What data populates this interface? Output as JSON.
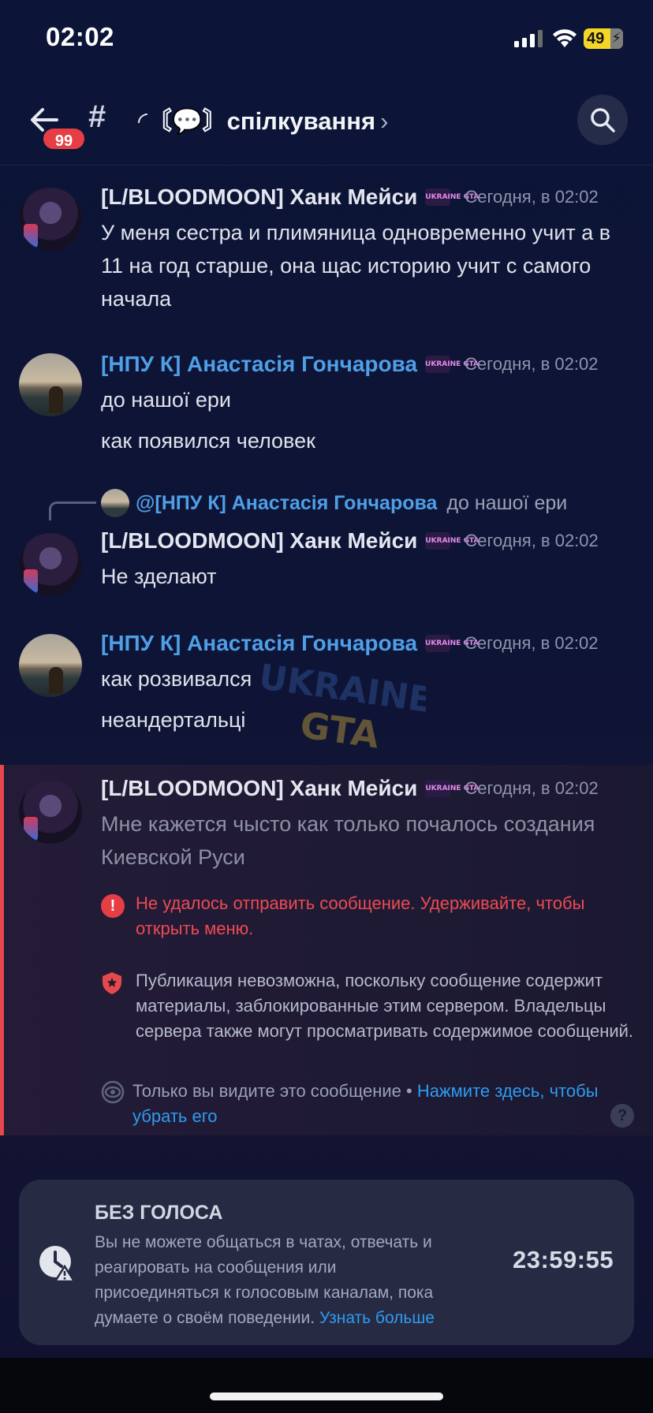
{
  "status_bar": {
    "time": "02:02",
    "battery": "49"
  },
  "header": {
    "unread_count": "99",
    "channel_title": "◜〘💬〙спілкування",
    "chevron": "›"
  },
  "messages": [
    {
      "author": "[L/BLOODMOON] Ханк Мейси",
      "tag": "UKRAINE GTA",
      "timestamp": "Сегодня, в 02:02",
      "lines": [
        "У меня сестра и плимяница одновременно учит а в 11 на год старше, она щас историю учит с самого начала"
      ]
    },
    {
      "author": "[НПУ К] Анастасія Гончарова",
      "tag": "UKRAINE GTA",
      "timestamp": "Сегодня, в 02:02",
      "lines": [
        "до нашої ери",
        "как появился человек"
      ]
    },
    {
      "reply_mention": "@[НПУ К] Анастасія Гончарова",
      "reply_text": "до нашої ери",
      "author": "[L/BLOODMOON] Ханк Мейси",
      "tag": "UKRAINE GTA",
      "timestamp": "Сегодня, в 02:02",
      "lines": [
        "Не зделают"
      ]
    },
    {
      "author": "[НПУ К] Анастасія Гончарова",
      "tag": "UKRAINE GTA",
      "timestamp": "Сегодня, в 02:02",
      "lines": [
        "как розвивался",
        "неандертальці"
      ]
    },
    {
      "author": "[L/BLOODMOON] Ханк Мейси",
      "tag": "UKRAINE GTA",
      "timestamp": "Сегодня, в 02:02",
      "lines": [
        "Мне кажется чысто как только почалось создания Киевской Руси"
      ]
    }
  ],
  "watermark": {
    "line1": "UKRAINE",
    "line2": "GTA"
  },
  "failed": {
    "error": "Не удалось отправить сообщение. Удерживайте, чтобы открыть меню.",
    "blocked": "Публикация невозможна, поскольку сообщение содержит материалы, заблокированные этим сервером. Владельцы сервера также могут просматривать содержимое сообщений.",
    "only_you": "Только вы видите это сообщение • ",
    "dismiss": "Нажмите здесь, чтобы убрать его",
    "help": "?"
  },
  "timeout": {
    "title": "БЕЗ ГОЛОСА",
    "text": "Вы не можете общаться в чатах, отвечать и реагировать на сообщения или присоединяться к голосовым каналам, пока думаете о своём поведении. ",
    "learn_more": "Узнать больше",
    "timer": "23:59:55"
  },
  "colors": {
    "accent": "#2f9bf0",
    "error": "#e53e45",
    "role_blue": "#4e9fe6"
  }
}
